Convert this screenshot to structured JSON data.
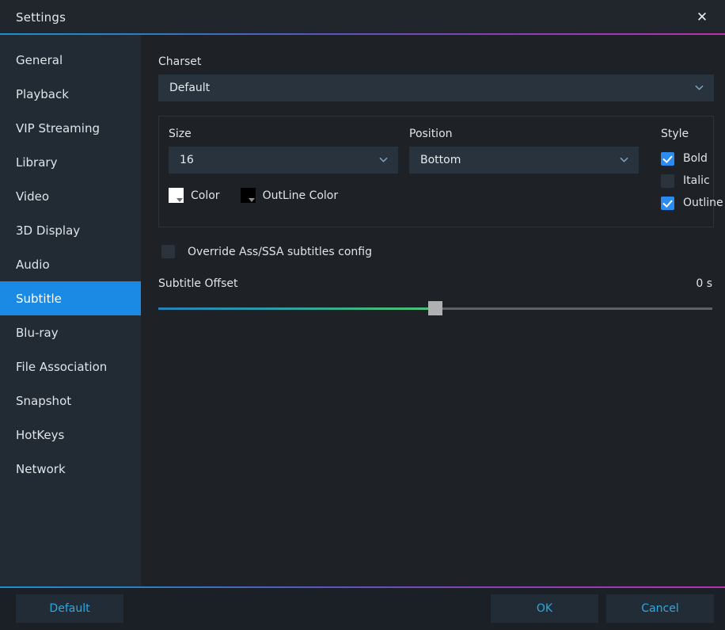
{
  "window": {
    "title": "Settings",
    "close_icon": "close-icon"
  },
  "theme": {
    "accent_blue": "#1a8ae5",
    "link_blue": "#2ea8e0",
    "checkbox_checked": "#2a8cf0",
    "sidebar_bg": "#222a33",
    "content_bg": "#1e2227",
    "gradient_start": "#1d8fd1",
    "gradient_end": "#b832b0",
    "slider_fill_end": "#4bc07a",
    "thumb": "#aeb0b2"
  },
  "sidebar": {
    "items": [
      {
        "label": "General",
        "selected": false
      },
      {
        "label": "Playback",
        "selected": false
      },
      {
        "label": "VIP Streaming",
        "selected": false
      },
      {
        "label": "Library",
        "selected": false
      },
      {
        "label": "Video",
        "selected": false
      },
      {
        "label": "3D Display",
        "selected": false
      },
      {
        "label": "Audio",
        "selected": false
      },
      {
        "label": "Subtitle",
        "selected": true
      },
      {
        "label": "Blu-ray",
        "selected": false
      },
      {
        "label": "File Association",
        "selected": false
      },
      {
        "label": "Snapshot",
        "selected": false
      },
      {
        "label": "HotKeys",
        "selected": false
      },
      {
        "label": "Network",
        "selected": false
      }
    ]
  },
  "content": {
    "charset": {
      "label": "Charset",
      "value": "Default",
      "chevron_icon": "chevron-down-icon"
    },
    "size": {
      "label": "Size",
      "value": "16",
      "chevron_icon": "chevron-down-icon"
    },
    "position": {
      "label": "Position",
      "value": "Bottom",
      "chevron_icon": "chevron-down-icon"
    },
    "style": {
      "label": "Style",
      "options": [
        {
          "label": "Bold",
          "checked": true
        },
        {
          "label": "Italic",
          "checked": false
        },
        {
          "label": "Outline",
          "checked": true
        }
      ]
    },
    "color": {
      "label": "Color",
      "swatch": "#ffffff"
    },
    "outline_color": {
      "label": "OutLine Color",
      "swatch": "#000000"
    },
    "override": {
      "label": "Override Ass/SSA subtitles config",
      "checked": false
    },
    "subtitle_offset": {
      "label": "Subtitle Offset",
      "value_text": "0 s",
      "percent": 50
    }
  },
  "footer": {
    "default_label": "Default",
    "ok_label": "OK",
    "cancel_label": "Cancel"
  }
}
